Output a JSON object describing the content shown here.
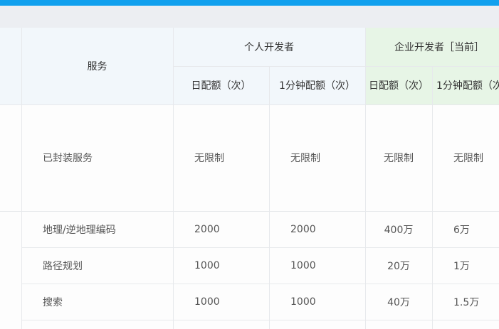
{
  "header": {
    "service": "服务",
    "personal": "个人开发者",
    "enterprise": "企业开发者［当前］",
    "daily_quota": "日配额（次）",
    "minute_quota_personal": "1分钟配额（次）",
    "daily_quota_ent": "日配额（次）",
    "minute_quota_ent": "1分钟配额（次"
  },
  "rows": [
    {
      "service": "已封装服务",
      "p_day": "无限制",
      "p_min": "无限制",
      "e_day": "无限制",
      "e_min": "无限制"
    },
    {
      "service": "地理/逆地理编码",
      "p_day": "2000",
      "p_min": "2000",
      "e_day": "400万",
      "e_min": "6万"
    },
    {
      "service": "路径规划",
      "p_day": "1000",
      "p_min": "1000",
      "e_day": "20万",
      "e_min": "1万"
    },
    {
      "service": "搜索",
      "p_day": "1000",
      "p_min": "1000",
      "e_day": "40万",
      "e_min": "1.5万"
    }
  ]
}
